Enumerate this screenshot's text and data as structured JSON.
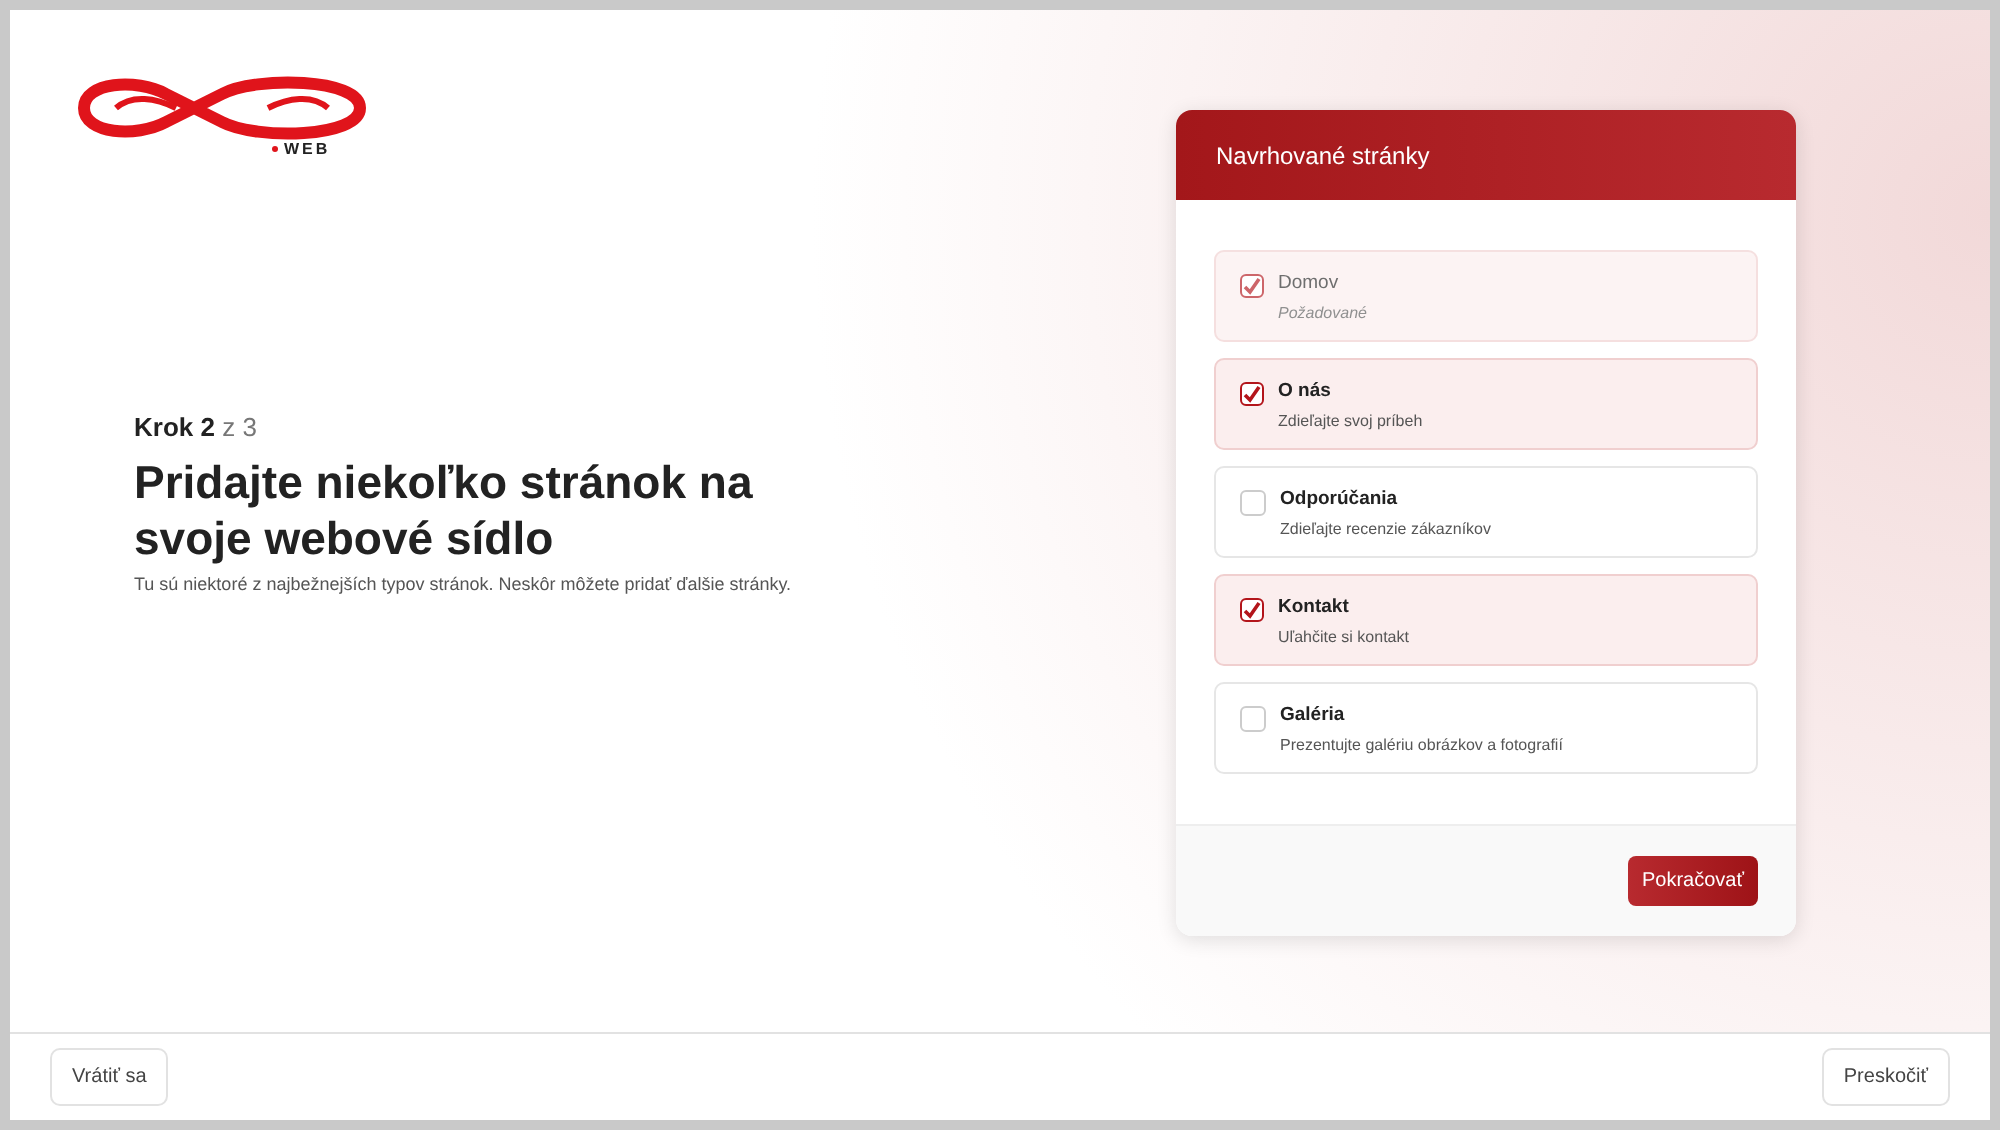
{
  "logo": {
    "subtext": "WEB"
  },
  "step": {
    "label": "Krok",
    "current": "2",
    "separator": "z",
    "total": "3"
  },
  "title": "Pridajte niekoľko stránok na svoje webové sídlo",
  "subtitle": "Tu sú niektoré z najbežnejších typov stránok. Neskôr môžete pridať ďalšie stránky.",
  "panel": {
    "title": "Navrhované stránky",
    "pages": [
      {
        "name": "Domov",
        "description": "Požadované",
        "checked": true,
        "disabled": true
      },
      {
        "name": "O nás",
        "description": "Zdieľajte svoj príbeh",
        "checked": true,
        "disabled": false
      },
      {
        "name": "Odporúčania",
        "description": "Zdieľajte recenzie zákazníkov",
        "checked": false,
        "disabled": false
      },
      {
        "name": "Kontakt",
        "description": "Uľahčite si kontakt",
        "checked": true,
        "disabled": false
      },
      {
        "name": "Galéria",
        "description": "Prezentujte galériu obrázkov a fotografií",
        "checked": false,
        "disabled": false
      }
    ],
    "continue_button": "Pokračovať"
  },
  "footer": {
    "back_button": "Vrátiť sa",
    "skip_button": "Preskočiť"
  }
}
